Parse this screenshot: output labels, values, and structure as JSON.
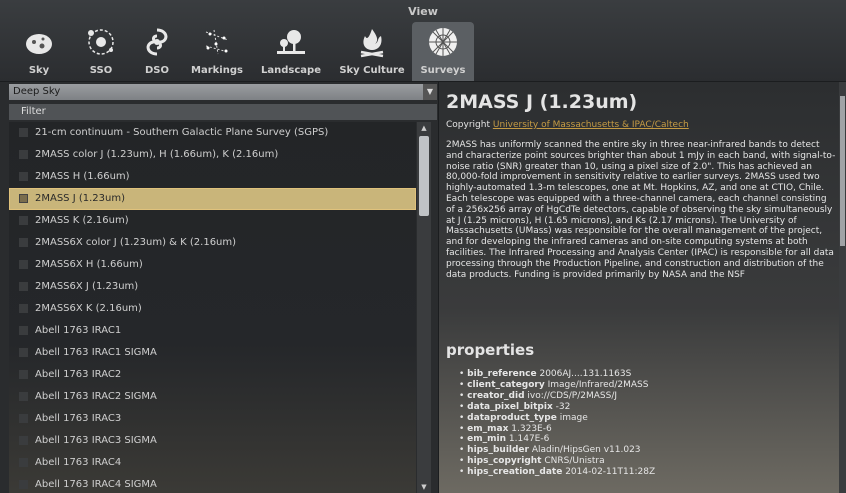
{
  "window": {
    "title": "View"
  },
  "tabs": [
    {
      "label": "Sky",
      "icon": "sky-icon"
    },
    {
      "label": "SSO",
      "icon": "sso-icon"
    },
    {
      "label": "DSO",
      "icon": "dso-icon"
    },
    {
      "label": "Markings",
      "icon": "markings-icon"
    },
    {
      "label": "Landscape",
      "icon": "landscape-icon"
    },
    {
      "label": "Sky Culture",
      "icon": "sky-culture-icon"
    },
    {
      "label": "Surveys",
      "icon": "surveys-icon",
      "active": true
    }
  ],
  "category_select": {
    "value": "Deep Sky"
  },
  "filter": {
    "placeholder": "Filter"
  },
  "surveys": [
    "21-cm continuum - Southern Galactic Plane Survey (SGPS)",
    "2MASS color J (1.23um), H (1.66um), K (2.16um)",
    "2MASS H (1.66um)",
    "2MASS J (1.23um)",
    "2MASS K (2.16um)",
    "2MASS6X color J (1.23um) & K (2.16um)",
    "2MASS6X H (1.66um)",
    "2MASS6X J (1.23um)",
    "2MASS6X K (2.16um)",
    "Abell 1763 IRAC1",
    "Abell 1763 IRAC1 SIGMA",
    "Abell 1763 IRAC2",
    "Abell 1763 IRAC2 SIGMA",
    "Abell 1763 IRAC3",
    "Abell 1763 IRAC3 SIGMA",
    "Abell 1763 IRAC4",
    "Abell 1763 IRAC4 SIGMA"
  ],
  "selected_index": 3,
  "detail": {
    "title": "2MASS J (1.23um)",
    "copyright_label": "Copyright",
    "copyright_link": "University of Massachusetts & IPAC/Caltech",
    "description": "2MASS has uniformly scanned the entire sky in three near-infrared bands to detect and characterize point sources brighter than about 1 mJy in each band, with signal-to-noise ratio (SNR) greater than 10, using a pixel size of 2.0\". This has achieved an 80,000-fold improvement in sensitivity relative to earlier surveys. 2MASS used two highly-automated 1.3-m telescopes, one at Mt. Hopkins, AZ, and one at CTIO, Chile. Each telescope was equipped with a three-channel camera, each channel consisting of a 256x256 array of HgCdTe detectors, capable of observing the sky simultaneously at J (1.25 microns), H (1.65 microns), and Ks (2.17 microns). The University of Massachusetts (UMass) was responsible for the overall management of the project, and for developing the infrared cameras and on-site computing systems at both facilities. The Infrared Processing and Analysis Center (IPAC) is responsible for all data processing through the Production Pipeline, and construction and distribution of the data products. Funding is provided primarily by NASA and the NSF",
    "properties_heading": "properties",
    "properties": [
      {
        "key": "bib_reference",
        "value": "2006AJ....131.1163S"
      },
      {
        "key": "client_category",
        "value": "Image/Infrared/2MASS"
      },
      {
        "key": "creator_did",
        "value": "ivo://CDS/P/2MASS/J"
      },
      {
        "key": "data_pixel_bitpix",
        "value": "-32"
      },
      {
        "key": "dataproduct_type",
        "value": "image"
      },
      {
        "key": "em_max",
        "value": "1.323E-6"
      },
      {
        "key": "em_min",
        "value": "1.147E-6"
      },
      {
        "key": "hips_builder",
        "value": "Aladin/HipsGen v11.023"
      },
      {
        "key": "hips_copyright",
        "value": "CNRS/Unistra"
      },
      {
        "key": "hips_creation_date",
        "value": "2014-02-11T11:28Z"
      }
    ]
  },
  "colors": {
    "accent": "#c9b57a",
    "link": "#c59b44"
  }
}
